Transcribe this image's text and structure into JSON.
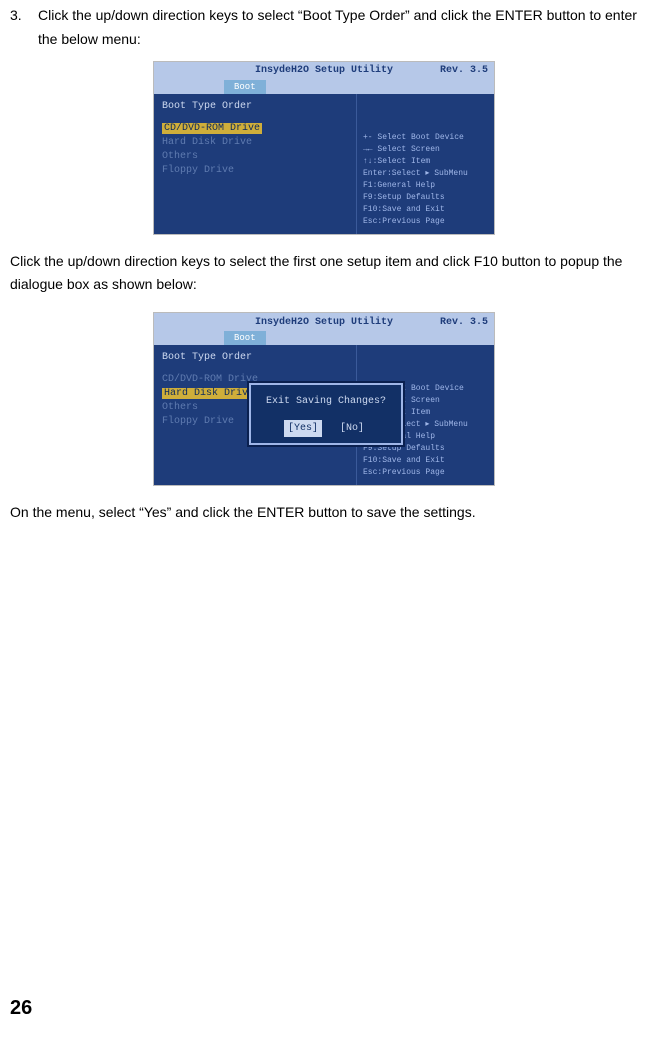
{
  "step3": {
    "num": "3.",
    "text": "Click the up/down direction keys to select “Boot Type Order” and click the ENTER button to enter the below menu:"
  },
  "para2": "Click the up/down direction keys to select the first one setup item and click F10 button to popup the dialogue box as shown below:",
  "para3": "On the menu, select “Yes” and click the ENTER button to save the settings.",
  "page_number": "26",
  "bios_common": {
    "title_center": "InsydeH2O Setup Utility",
    "title_right": "Rev. 3.5",
    "tab": "Boot",
    "heading": "Boot Type Order",
    "items": {
      "cd": "CD/DVD-ROM Drive",
      "hdd": "Hard Disk Drive",
      "others": "Others",
      "floppy": "Floppy Drive"
    },
    "help": {
      "l1": "+-   Select Boot Device",
      "l2": "→←   Select Screen",
      "l3": "↑↓:Select Item",
      "l4": "Enter:Select ▸ SubMenu",
      "l5": "F1:General Help",
      "l6": "F9:Setup Defaults",
      "l7": "F10:Save and Exit",
      "l8": "Esc:Previous Page"
    }
  },
  "dialog": {
    "question": "Exit Saving Changes?",
    "yes": "[Yes]",
    "no": "[No]"
  }
}
